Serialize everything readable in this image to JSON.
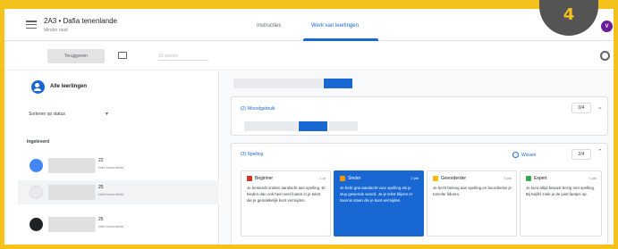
{
  "header": {
    "class_title": "2A3 • Dafia tenenlande",
    "class_subtitle": "Minder raad",
    "tabs": [
      {
        "label": "Instructies",
        "active": false
      },
      {
        "label": "Werk van leerlingen",
        "active": true
      }
    ],
    "avatar_letter": "V"
  },
  "toolbar": {
    "return_label": "Teruggeven",
    "points_placeholder": "10 punten"
  },
  "sidebar": {
    "title": "Alle leerlingen",
    "sort_label": "Sorteren op status",
    "section_label": "Ingeleverd",
    "students": [
      {
        "score": "22",
        "status": "Niet beoordeeld",
        "avatar_color": "#4285f4",
        "selected": false
      },
      {
        "score": "25",
        "status": "Niet beoordeeld",
        "avatar_color": "#e8eaed",
        "selected": true
      },
      {
        "score": "25",
        "status": "Niet beoordeeld",
        "avatar_color": "#202124",
        "selected": false
      }
    ]
  },
  "rubric": {
    "criterion_2": {
      "title": "(2) Woordgebruik",
      "score": "0/4"
    },
    "criterion_3": {
      "title": "(3) Spelling",
      "clear_label": "Wissen",
      "score": "2/4",
      "levels": [
        {
          "name": "Beginner",
          "points": "1 pt",
          "color": "#d93025",
          "selected": false,
          "desc": "Je besteedt ontdes aandacht aan spelling. Er bieden dan ook heel veel fouten in je tekst die je gemakkelijk kunt vermijden."
        },
        {
          "name": "Sinder",
          "points": "2 pts",
          "color": "#f29900",
          "selected": true,
          "desc": "Je hebt gna aandacht voor spelling als je stuy gewende woord. Je je tekst blijven er taxonis staan die je kunt vermijden."
        },
        {
          "name": "Gevorderder",
          "points": "3 pts",
          "color": "#fbbc04",
          "selected": false,
          "desc": "Je lecht beleeg aan spelling en beordeelse je tomelte fiduren."
        },
        {
          "name": "Expert",
          "points": "4 pts",
          "color": "#34a853",
          "selected": false,
          "desc": "Je kunt altijd bewust bezig met spelling. Bij twijfel zoek je de juist faetjes op."
        }
      ]
    }
  },
  "badge": {
    "number": "4"
  }
}
